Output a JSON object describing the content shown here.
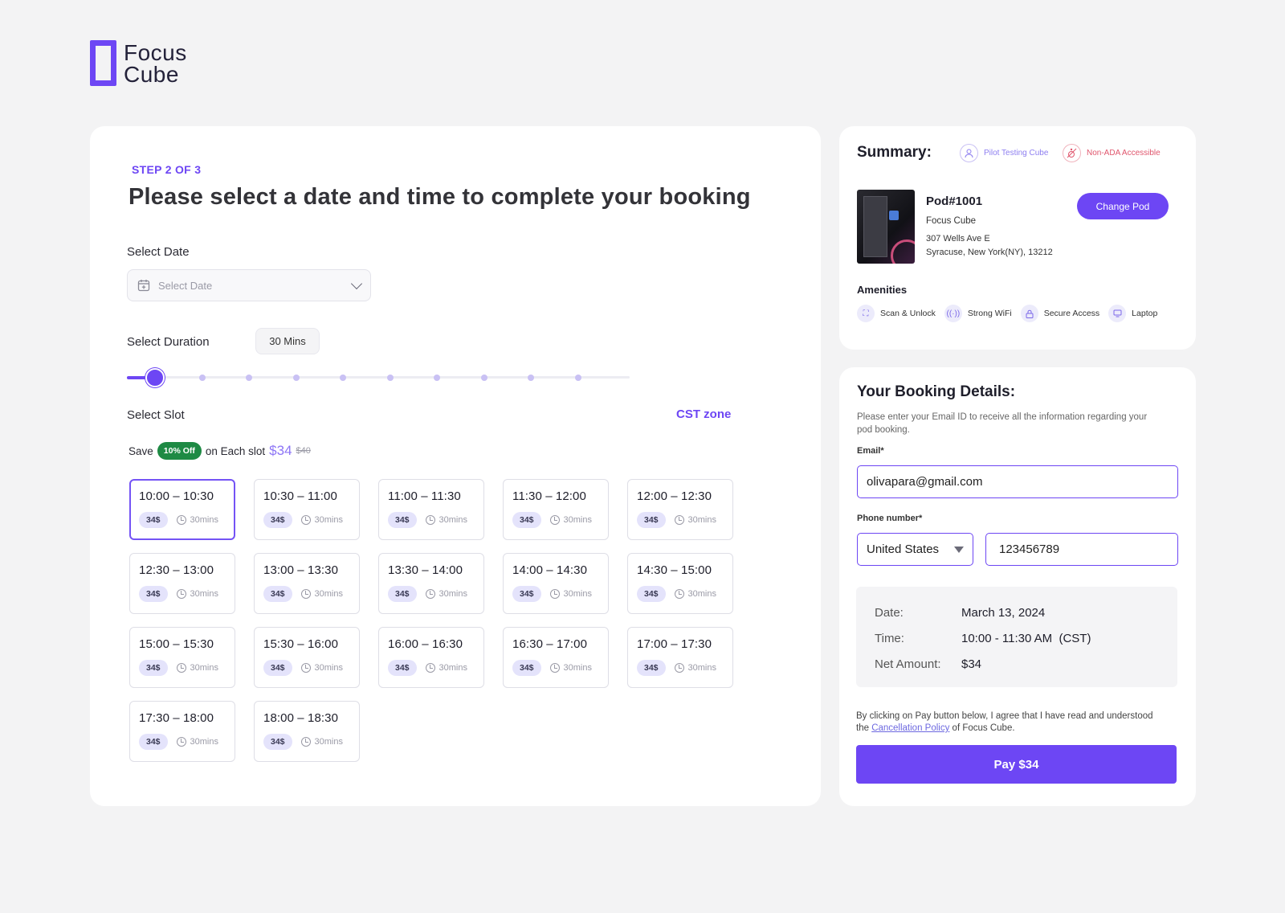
{
  "brand": {
    "line1": "Focus",
    "line2": "Cube",
    "accent": "#6d46f4"
  },
  "main": {
    "step": "STEP 2 OF 3",
    "title": "Please select a date and time to complete your booking",
    "date_label": "Select Date",
    "date_placeholder": "Select Date",
    "duration_label": "Select Duration",
    "duration_value": "30 Mins",
    "duration_slider": {
      "steps": 10,
      "selected_index": 0
    },
    "slot_label": "Select Slot",
    "timezone": "CST zone",
    "save": {
      "prefix": "Save",
      "badge": "10% Off",
      "middle": "on Each slot",
      "price": "$34",
      "old_price": "$40"
    },
    "selected_slot_index": 0,
    "slots": [
      {
        "time": "10:00 – 10:30",
        "price": "34$",
        "duration": "30mins"
      },
      {
        "time": "10:30 – 11:00",
        "price": "34$",
        "duration": "30mins"
      },
      {
        "time": "11:00 – 11:30",
        "price": "34$",
        "duration": "30mins"
      },
      {
        "time": "11:30 – 12:00",
        "price": "34$",
        "duration": "30mins"
      },
      {
        "time": "12:00 – 12:30",
        "price": "34$",
        "duration": "30mins"
      },
      {
        "time": "12:30 – 13:00",
        "price": "34$",
        "duration": "30mins"
      },
      {
        "time": "13:00 – 13:30",
        "price": "34$",
        "duration": "30mins"
      },
      {
        "time": "13:30 – 14:00",
        "price": "34$",
        "duration": "30mins"
      },
      {
        "time": "14:00 – 14:30",
        "price": "34$",
        "duration": "30mins"
      },
      {
        "time": "14:30 – 15:00",
        "price": "34$",
        "duration": "30mins"
      },
      {
        "time": "15:00 – 15:30",
        "price": "34$",
        "duration": "30mins"
      },
      {
        "time": "15:30 – 16:00",
        "price": "34$",
        "duration": "30mins"
      },
      {
        "time": "16:00 – 16:30",
        "price": "34$",
        "duration": "30mins"
      },
      {
        "time": "16:30 – 17:00",
        "price": "34$",
        "duration": "30mins"
      },
      {
        "time": "17:00 – 17:30",
        "price": "34$",
        "duration": "30mins"
      },
      {
        "time": "17:30 – 18:00",
        "price": "34$",
        "duration": "30mins"
      },
      {
        "time": "18:00 – 18:30",
        "price": "34$",
        "duration": "30mins"
      }
    ]
  },
  "summary": {
    "title": "Summary:",
    "tag_pilot": "Pilot Testing Cube",
    "tag_ada": "Non-ADA Accessible",
    "pod_name": "Pod#1001",
    "pod_brand": "Focus Cube",
    "address_line1": "307 Wells Ave E",
    "address_line2": "Syracuse, New York(NY), 13212",
    "change_button": "Change Pod",
    "amenities_title": "Amenities",
    "amenities": [
      "Scan & Unlock",
      "Strong WiFi",
      "Secure Access",
      "Laptop"
    ]
  },
  "booking": {
    "title": "Your Booking Details:",
    "description": "Please enter your Email ID to receive all the information regarding your pod booking.",
    "email_label": "Email*",
    "email_value": "olivapara@gmail.com",
    "phone_label": "Phone number*",
    "country": "United States",
    "phone_value": "123456789",
    "details": {
      "date_key": "Date:",
      "date_val": "March 13, 2024",
      "time_key": "Time:",
      "time_val": "10:00 - 11:30 AM  (CST)",
      "amount_key": "Net Amount:",
      "amount_val": "$34"
    },
    "agree_prefix": "By clicking on Pay button below, I agree that I have read and understood the ",
    "policy_link": "Cancellation Policy",
    "agree_suffix": " of Focus Cube.",
    "pay_button": "Pay $34"
  }
}
